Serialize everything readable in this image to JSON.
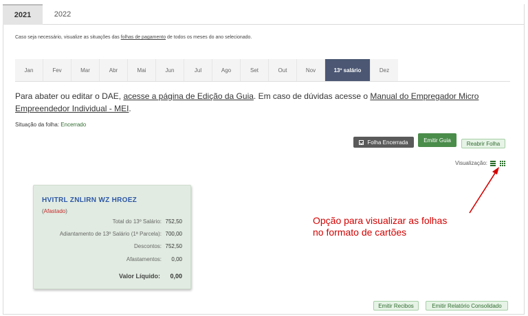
{
  "year_tabs": [
    {
      "label": "2021",
      "active": true
    },
    {
      "label": "2022",
      "active": false
    }
  ],
  "hint": {
    "before": "Caso seja necessário, visualize as situações das ",
    "link": "folhas de pagamento",
    "after": " de todos os meses do ano selecionado."
  },
  "months": [
    "Jan",
    "Fev",
    "Mar",
    "Abr",
    "Mai",
    "Jun",
    "Jul",
    "Ago",
    "Set",
    "Out",
    "Nov",
    "13º salário",
    "Dez"
  ],
  "active_month": "13º salário",
  "dae": {
    "t1": "Para abater ou editar o DAE, ",
    "link1": "acesse a página de Edição da Guia",
    "t2": ". Em caso de dúvidas acesse o ",
    "link2": "Manual do Empregador Micro Empreendedor Individual - MEI",
    "t3": "."
  },
  "situacao": {
    "label": "Situação da folha: ",
    "value": "Encerrado"
  },
  "buttons": {
    "folha_encerrada": "Folha Encerrada",
    "emitir_guia": "Emitir Guia",
    "reabrir_folha": "Reabrir Folha",
    "emitir_recibos": "Emitir Recibos",
    "emitir_relatorio": "Emitir Relatório Consolidado"
  },
  "visualizacao": {
    "label": "Visualização:",
    "list_icon": "list-icon",
    "grid_icon": "grid-icon"
  },
  "card": {
    "name": "HVITRL ZNLIRN WZ HROEZ",
    "status": "Afastado",
    "rows": [
      {
        "label": "Total do 13º Salário:",
        "value": "752,50"
      },
      {
        "label": "Adiantamento de 13º Salário (1ª Parcela):",
        "value": "700,00"
      },
      {
        "label": "Descontos:",
        "value": "752,50"
      },
      {
        "label": "Afastamentos:",
        "value": "0,00"
      }
    ],
    "total": {
      "label": "Valor Líquido:",
      "value": "0,00"
    }
  },
  "annotation": {
    "line1": "Opção para visualizar as folhas",
    "line2": "no formato de cartões",
    "color": "#d40000"
  },
  "colors": {
    "accent": "#4b5773",
    "green": "#4a8c4a",
    "blue_name": "#2e58a6"
  }
}
